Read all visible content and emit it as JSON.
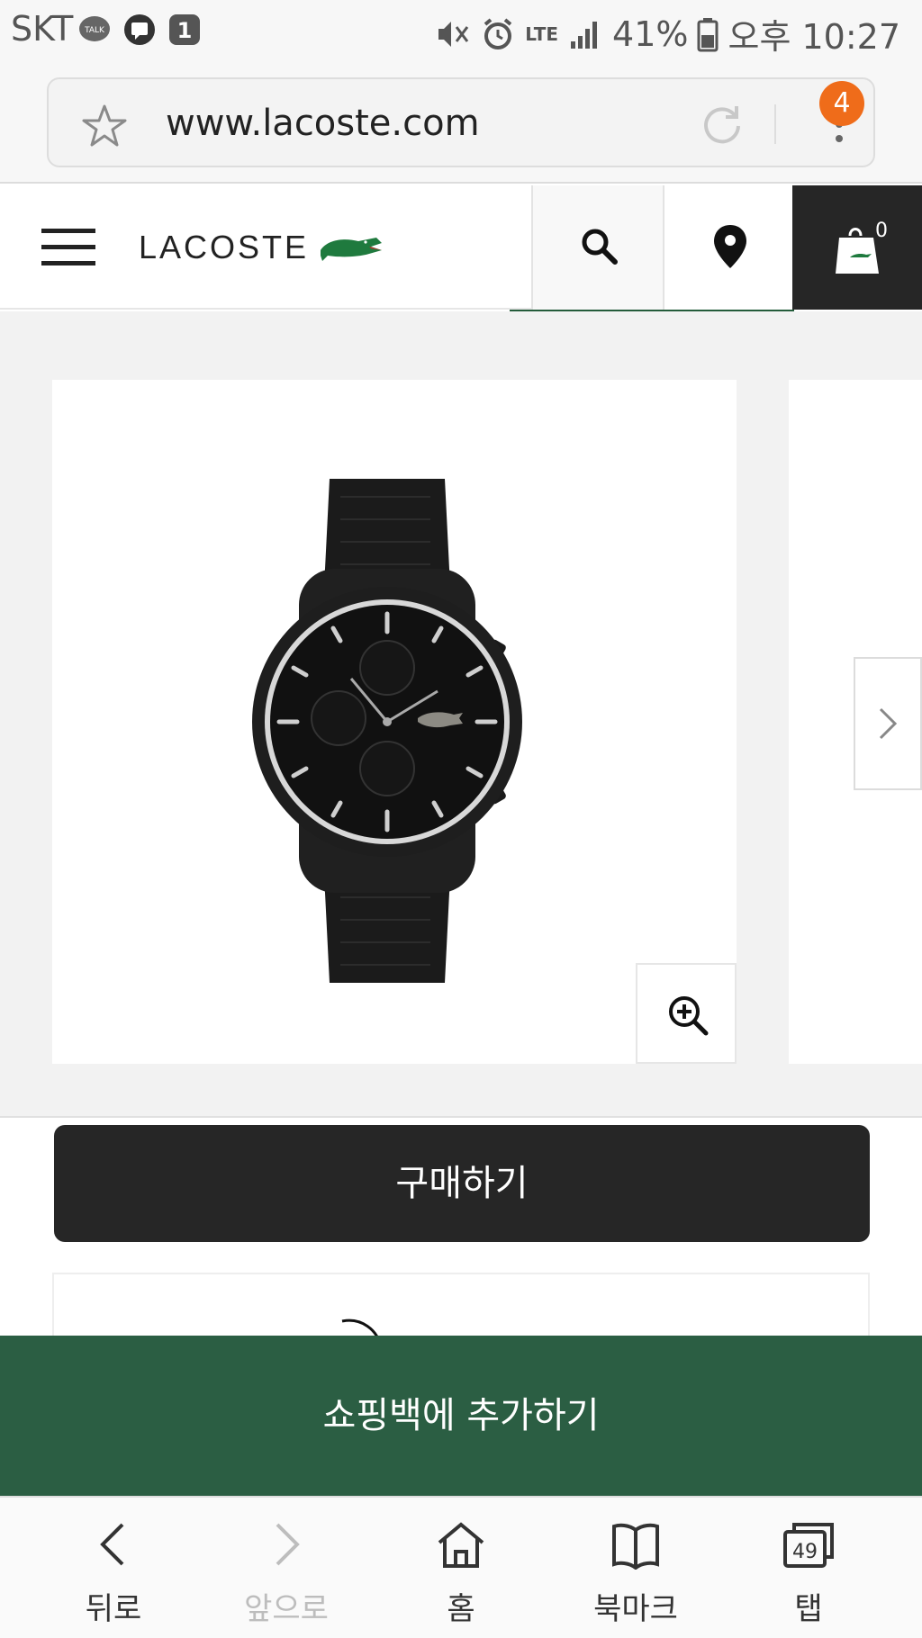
{
  "status_bar": {
    "carrier": "SKT",
    "talk_badge": "TALK",
    "notification_count": "1",
    "network": "LTE",
    "battery": "41%",
    "time": "오후 10:27"
  },
  "address_bar": {
    "url": "www.lacoste.com",
    "menu_badge": "4"
  },
  "site_header": {
    "logo": "LACOSTE",
    "cart_count": "0"
  },
  "product": {
    "image_alt": "black Lacoste chronograph watch",
    "zoom_icon": "zoom-in-icon",
    "next_icon": "chevron-right-icon"
  },
  "actions": {
    "buy_label": "구매하기",
    "add_to_bag_label": "쇼핑백에 추가하기"
  },
  "browser_nav": {
    "items": [
      {
        "label": "뒤로",
        "icon": "back-icon",
        "enabled": true
      },
      {
        "label": "앞으로",
        "icon": "forward-icon",
        "enabled": false
      },
      {
        "label": "홈",
        "icon": "home-icon",
        "enabled": true
      },
      {
        "label": "북마크",
        "icon": "bookmark-icon",
        "enabled": true
      },
      {
        "label": "탭",
        "icon": "tabs-icon",
        "enabled": true,
        "count": "49"
      }
    ]
  },
  "colors": {
    "brand_green": "#2b5e43",
    "dark_button": "#262626",
    "badge_orange": "#ef6c1a"
  }
}
